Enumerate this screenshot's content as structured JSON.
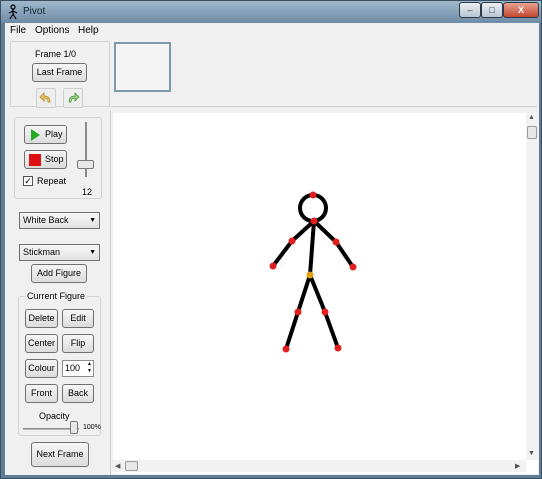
{
  "window": {
    "title": "Pivot",
    "controls": {
      "minimize": "–",
      "maximize": "□",
      "close": "X"
    }
  },
  "menu": [
    "File",
    "Options",
    "Help"
  ],
  "frames": {
    "label": "Frame 1/0",
    "last_frame": "Last Frame",
    "undo_icon": "undo-arrow-icon",
    "redo_icon": "redo-arrow-icon"
  },
  "playback": {
    "play": "Play",
    "stop": "Stop",
    "repeat_label": "Repeat",
    "repeat_checked": true,
    "speed_value": "12"
  },
  "background_select": "White Back",
  "figure_type_select": "Stickman",
  "add_figure": "Add Figure",
  "current_figure": {
    "title": "Current Figure",
    "delete": "Delete",
    "edit": "Edit",
    "center": "Center",
    "flip": "Flip",
    "colour": "Colour",
    "size_value": "100",
    "front": "Front",
    "back": "Back",
    "opacity_label": "Opacity",
    "opacity_value": "100%"
  },
  "next_frame": "Next Frame",
  "colors": {
    "joint_handle": "#e02020",
    "origin_handle": "#e0a010",
    "stick": "#000000",
    "play_icon": "#22aa22",
    "stop_icon": "#dd1111"
  }
}
